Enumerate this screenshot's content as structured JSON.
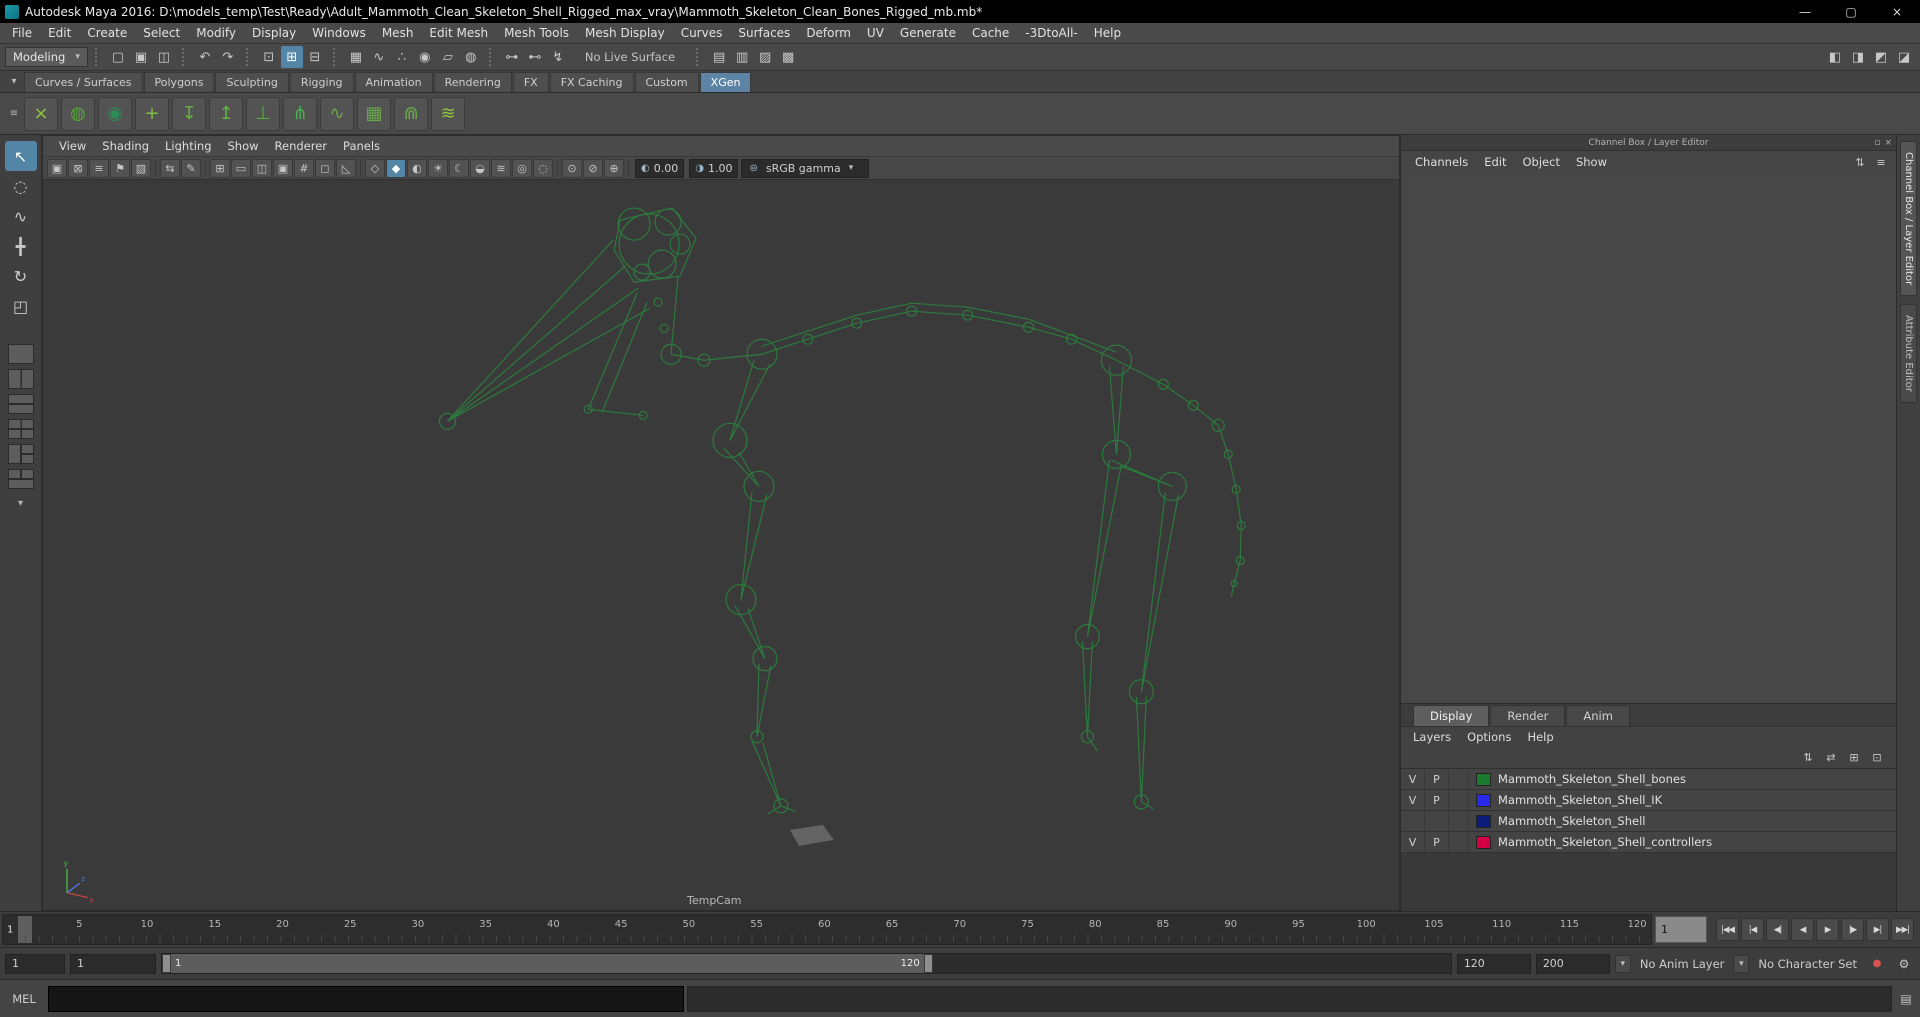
{
  "window": {
    "title": "Autodesk Maya 2016: D:\\models_temp\\Test\\Ready\\Adult_Mammoth_Clean_Skeleton_Shell_Rigged_max_vray\\Mammoth_Skeleton_Clean_Bones_Rigged_mb.mb*",
    "minimize": "—",
    "maximize": "▢",
    "close": "×"
  },
  "glyphs": {
    "dropdown_arrow": "▾"
  },
  "menus": [
    "File",
    "Edit",
    "Create",
    "Select",
    "Modify",
    "Display",
    "Windows",
    "Mesh",
    "Edit Mesh",
    "Mesh Tools",
    "Mesh Display",
    "Curves",
    "Surfaces",
    "Deform",
    "UV",
    "Generate",
    "Cache",
    "-3DtoAll-",
    "Help"
  ],
  "status_line": {
    "menu_set": "Modeling",
    "file_icons": [
      {
        "name": "new-scene-icon",
        "glyph": "▢"
      },
      {
        "name": "open-scene-icon",
        "glyph": "▣"
      },
      {
        "name": "save-scene-icon",
        "glyph": "◫"
      }
    ],
    "undo_icons": [
      {
        "name": "undo-icon",
        "glyph": "↶"
      },
      {
        "name": "redo-icon",
        "glyph": "↷"
      }
    ],
    "selection_icons": [
      {
        "name": "select-hierarchy-icon",
        "glyph": "⊡"
      },
      {
        "name": "select-object-icon",
        "glyph": "⊞",
        "active": true
      },
      {
        "name": "select-component-icon",
        "glyph": "⊟"
      }
    ],
    "snap_icons": [
      {
        "name": "snap-to-grids-icon",
        "glyph": "▦"
      },
      {
        "name": "snap-to-curves-icon",
        "glyph": "∿"
      },
      {
        "name": "snap-to-points-icon",
        "glyph": "∴"
      },
      {
        "name": "snap-to-projected-center-icon",
        "glyph": "◉"
      },
      {
        "name": "snap-to-view-planes-icon",
        "glyph": "▱"
      },
      {
        "name": "make-live-icon",
        "glyph": "◍"
      }
    ],
    "construction_icons": [
      {
        "name": "input-connections-icon",
        "glyph": "⊶"
      },
      {
        "name": "output-connections-icon",
        "glyph": "⊷"
      },
      {
        "name": "construction-history-icon",
        "glyph": "↯"
      }
    ],
    "live_surface_label": "No Live Surface",
    "render_icons": [
      {
        "name": "open-render-view-icon",
        "glyph": "▤"
      },
      {
        "name": "render-current-frame-icon",
        "glyph": "▥"
      },
      {
        "name": "ipr-render-icon",
        "glyph": "▨"
      },
      {
        "name": "render-settings-icon",
        "glyph": "▩"
      }
    ],
    "sidebar_icons": [
      {
        "name": "toggle-modeling-toolkit-icon",
        "glyph": "◧"
      },
      {
        "name": "toggle-attribute-editor-icon",
        "glyph": "◨"
      },
      {
        "name": "toggle-tool-settings-icon",
        "glyph": "◩"
      },
      {
        "name": "toggle-channel-box-icon",
        "glyph": "◪"
      }
    ]
  },
  "shelf": {
    "menu_icons": [
      {
        "name": "shelf-tab-options-icon",
        "glyph": "▾"
      },
      {
        "name": "shelf-menu-icon",
        "glyph": "≡"
      }
    ],
    "tabs": [
      {
        "label": "Curves / Surfaces"
      },
      {
        "label": "Polygons"
      },
      {
        "label": "Sculpting"
      },
      {
        "label": "Rigging"
      },
      {
        "label": "Animation"
      },
      {
        "label": "Rendering"
      },
      {
        "label": "FX"
      },
      {
        "label": "FX Caching"
      },
      {
        "label": "Custom"
      },
      {
        "label": "XGen",
        "active": true
      }
    ],
    "icons": [
      {
        "name": "xgen-open-editor-icon",
        "glyph": "×",
        "color": "#8dc63f"
      },
      {
        "name": "xgen-create-description-icon",
        "glyph": "◍",
        "color": "#57a639"
      },
      {
        "name": "xgen-sphere-groom-icon",
        "glyph": "◉",
        "color": "#2e8b57"
      },
      {
        "name": "xgen-add-collection-icon",
        "glyph": "+",
        "color": "#7cbf3f"
      },
      {
        "name": "xgen-attach-description-icon",
        "glyph": "↧",
        "color": "#67b346"
      },
      {
        "name": "xgen-export-patches-icon",
        "glyph": "↥",
        "color": "#67b346"
      },
      {
        "name": "xgen-guide-tool-icon",
        "glyph": "⊥",
        "color": "#5aa83e"
      },
      {
        "name": "xgen-place-guides-icon",
        "glyph": "⋔",
        "color": "#4caf50"
      },
      {
        "name": "xgen-comb-icon",
        "glyph": "∿",
        "color": "#6aa84f"
      },
      {
        "name": "xgen-density-mask-icon",
        "glyph": "▦",
        "color": "#6aa84f"
      },
      {
        "name": "xgen-clump-icon",
        "glyph": "⋒",
        "color": "#6aa84f"
      },
      {
        "name": "xgen-preview-icon",
        "glyph": "≋",
        "color": "#8dc63f"
      }
    ]
  },
  "toolbox": {
    "tools": [
      {
        "name": "select-tool",
        "glyph": "↖",
        "active": true
      },
      {
        "name": "lasso-select-tool",
        "glyph": "◌"
      },
      {
        "name": "paint-selection-tool",
        "glyph": "∿"
      },
      {
        "name": "move-tool",
        "glyph": "╋"
      },
      {
        "name": "rotate-tool",
        "glyph": "↻"
      },
      {
        "name": "scale-tool",
        "glyph": "◰"
      }
    ],
    "layouts": [
      {
        "name": "layout-single-pane-button",
        "variant": "single"
      },
      {
        "name": "layout-two-panes-side-by-side-button",
        "variant": "two-v"
      },
      {
        "name": "layout-two-panes-stacked-button",
        "variant": "two-h"
      },
      {
        "name": "layout-four-panes-button",
        "variant": "four"
      },
      {
        "name": "layout-three-panes-split-left-button",
        "variant": "three-l"
      },
      {
        "name": "layout-three-panes-split-bottom-button",
        "variant": "three-b"
      }
    ],
    "more_layouts_glyph": "▾"
  },
  "panel": {
    "menus": [
      "View",
      "Shading",
      "Lighting",
      "Show",
      "Renderer",
      "Panels"
    ],
    "camera_icons": [
      {
        "name": "select-camera-icon",
        "glyph": "▣"
      },
      {
        "name": "lock-camera-icon",
        "glyph": "⊠"
      },
      {
        "name": "camera-attributes-icon",
        "glyph": "≡"
      },
      {
        "name": "bookmarks-icon",
        "glyph": "⚑"
      },
      {
        "name": "image-plane-icon",
        "glyph": "▧"
      }
    ],
    "pan_icons": [
      {
        "name": "2d-pan-zoom-icon",
        "glyph": "⇆"
      },
      {
        "name": "grease-pencil-icon",
        "glyph": "✎"
      }
    ],
    "gate_icons": [
      {
        "name": "grid-icon",
        "glyph": "⊞"
      },
      {
        "name": "film-gate-icon",
        "glyph": "▭"
      },
      {
        "name": "resolution-gate-icon",
        "glyph": "◫"
      },
      {
        "name": "gate-mask-icon",
        "glyph": "▣"
      },
      {
        "name": "field-chart-icon",
        "glyph": "#"
      },
      {
        "name": "safe-action-icon",
        "glyph": "◻"
      },
      {
        "name": "safe-title-icon",
        "glyph": "◺"
      }
    ],
    "shading_icons": [
      {
        "name": "wireframe-icon",
        "glyph": "◇"
      },
      {
        "name": "shaded-icon",
        "glyph": "◆",
        "active": true
      },
      {
        "name": "textured-icon",
        "glyph": "◐"
      },
      {
        "name": "use-all-lights-icon",
        "glyph": "☀"
      },
      {
        "name": "shadows-icon",
        "glyph": "☾"
      },
      {
        "name": "screen-space-ao-icon",
        "glyph": "◒"
      },
      {
        "name": "anti-aliasing-icon",
        "glyph": "≋"
      },
      {
        "name": "depth-of-field-icon",
        "glyph": "◎"
      },
      {
        "name": "motion-blur-icon",
        "glyph": "◌"
      }
    ],
    "extra_icons": [
      {
        "name": "isolate-select-icon",
        "glyph": "⊙"
      },
      {
        "name": "xray-icon",
        "glyph": "⊘"
      },
      {
        "name": "xray-joints-icon",
        "glyph": "⊕"
      }
    ],
    "exposure": {
      "glyph": "◐",
      "value": "0.00"
    },
    "gamma": {
      "glyph": "◑",
      "value": "1.00"
    },
    "view_transform": {
      "glyph": "⊜",
      "value": "sRGB gamma"
    },
    "camera_label": "TempCam"
  },
  "channel_box": {
    "header": "Channel Box / Layer Editor",
    "header_icons": [
      {
        "name": "dock-panel-icon",
        "glyph": "▫"
      },
      {
        "name": "close-panel-icon",
        "glyph": "×"
      }
    ],
    "menus": [
      "Channels",
      "Edit",
      "Object",
      "Show"
    ],
    "corner_icons": [
      {
        "name": "channel-slider-mode-icon",
        "glyph": "⇅"
      },
      {
        "name": "channel-stats-icon",
        "glyph": "≡"
      }
    ]
  },
  "layer_editor": {
    "tabs": [
      {
        "label": "Display",
        "active": true
      },
      {
        "label": "Render"
      },
      {
        "label": "Anim"
      }
    ],
    "menus": [
      "Layers",
      "Options",
      "Help"
    ],
    "toolbar_icons": [
      {
        "name": "layers-sort-icon",
        "glyph": "⇅"
      },
      {
        "name": "layers-sync-icon",
        "glyph": "⇄"
      },
      {
        "name": "create-empty-layer-icon",
        "glyph": "⊞"
      },
      {
        "name": "create-layer-from-selected-icon",
        "glyph": "⊡"
      }
    ],
    "layers": [
      {
        "visible": "V",
        "playback": "P",
        "color": "#1b7a2d",
        "name": "Mammoth_Skeleton_Shell_bones"
      },
      {
        "visible": "V",
        "playback": "P",
        "color": "#2929e8",
        "name": "Mammoth_Skeleton_Shell_IK"
      },
      {
        "visible": "",
        "playback": "",
        "color": "#0d1d7d",
        "name": "Mammoth_Skeleton_Shell"
      },
      {
        "visible": "V",
        "playback": "P",
        "color": "#d40045",
        "name": "Mammoth_Skeleton_Shell_controllers"
      }
    ]
  },
  "sidebar": {
    "tabs": [
      {
        "label": "Channel Box / Layer Editor",
        "active": true
      },
      {
        "label": "Attribute Editor"
      }
    ]
  },
  "time_slider": {
    "current_frame": "1",
    "tick_labels": [
      5,
      10,
      15,
      20,
      25,
      30,
      35,
      40,
      45,
      50,
      55,
      60,
      65,
      70,
      75,
      80,
      85,
      90,
      95,
      100,
      105,
      110,
      115,
      120
    ],
    "frame_field": "1"
  },
  "playback_buttons": [
    {
      "name": "go-to-playback-start-button",
      "glyph": "|◀◀"
    },
    {
      "name": "step-back-one-key-button",
      "glyph": "|◀"
    },
    {
      "name": "step-back-one-frame-button",
      "glyph": "◀|"
    },
    {
      "name": "play-backwards-button",
      "glyph": "◀"
    },
    {
      "name": "play-forwards-button",
      "glyph": "▶"
    },
    {
      "name": "step-forward-one-frame-button",
      "glyph": "|▶"
    },
    {
      "name": "step-forward-one-key-button",
      "glyph": "▶|"
    },
    {
      "name": "go-to-playback-end-button",
      "glyph": "▶▶|"
    }
  ],
  "range_slider": {
    "animation_start": "1",
    "playback_start": "1",
    "bar_start_label": "1",
    "bar_end_label": "120",
    "playback_end": "120",
    "animation_end": "200",
    "anim_layer": "No Anim Layer",
    "character_set": "No Character Set",
    "autokey_glyph": "●",
    "prefs_glyph": "⚙"
  },
  "command_line": {
    "label": "MEL",
    "input_value": "",
    "script_editor_glyph": "▤"
  }
}
